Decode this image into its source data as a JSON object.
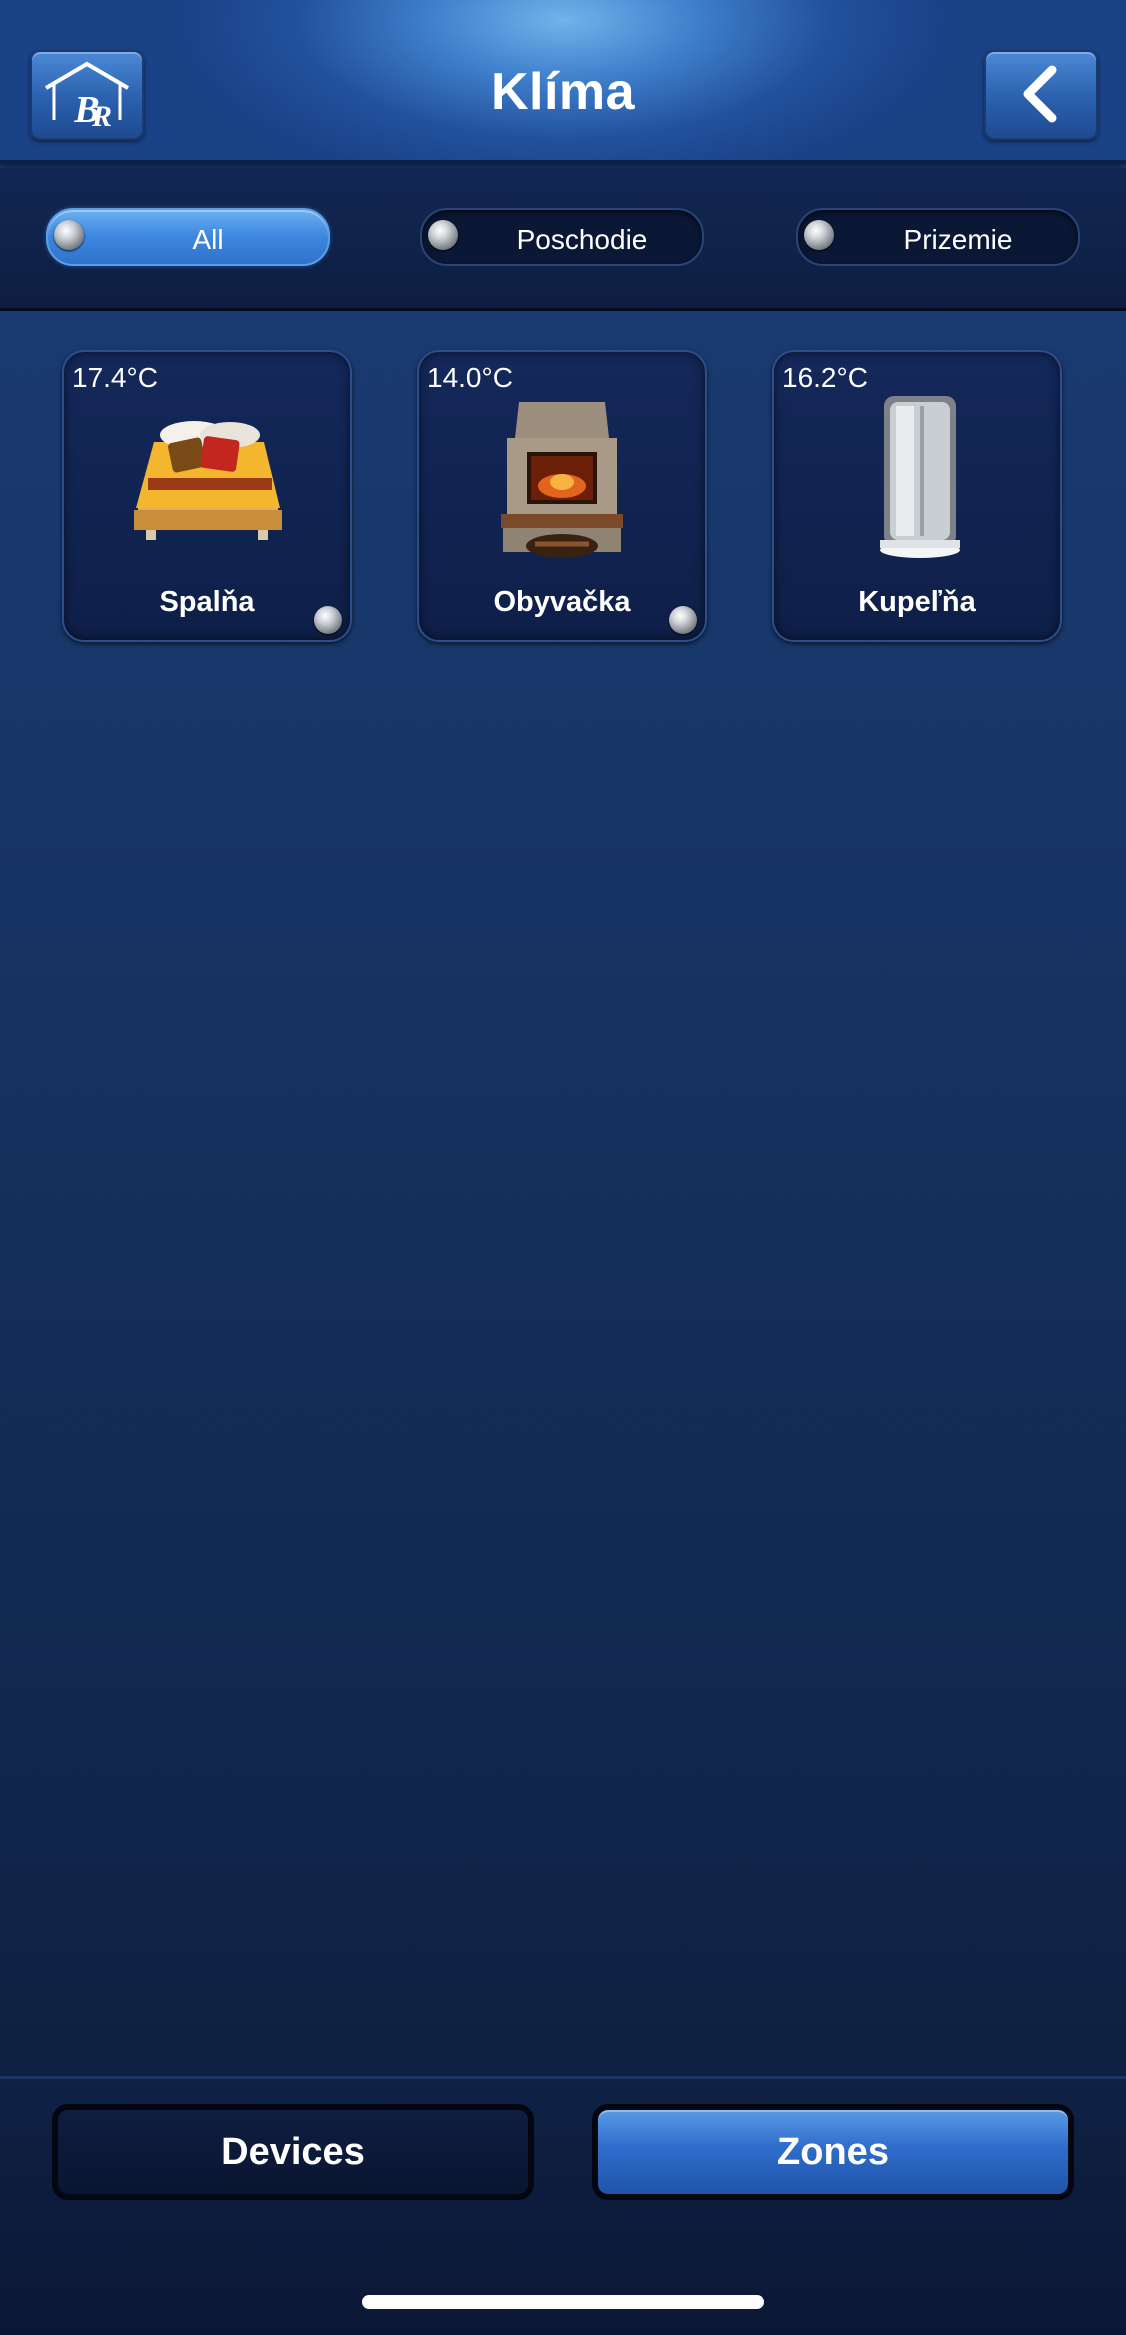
{
  "header": {
    "title": "Klíma",
    "home_icon": "house-logo-icon",
    "back_icon": "chevron-left-icon"
  },
  "filters": [
    {
      "label": "All",
      "active": true
    },
    {
      "label": "Poschodie",
      "active": false
    },
    {
      "label": "Prizemie",
      "active": false
    }
  ],
  "zones": [
    {
      "name": "Spalňa",
      "temperature": "17.4°C",
      "icon": "bed-icon",
      "has_indicator": true
    },
    {
      "name": "Obyvačka",
      "temperature": "14.0°C",
      "icon": "fireplace-icon",
      "has_indicator": true
    },
    {
      "name": "Kupeľňa",
      "temperature": "16.2°C",
      "icon": "shower-cabin-icon",
      "has_indicator": false
    }
  ],
  "bottom_bar": {
    "devices_label": "Devices",
    "zones_label": "Zones",
    "active": "Zones"
  },
  "colors": {
    "accent": "#3d86dd",
    "background": "#173566",
    "text": "#ffffff"
  }
}
